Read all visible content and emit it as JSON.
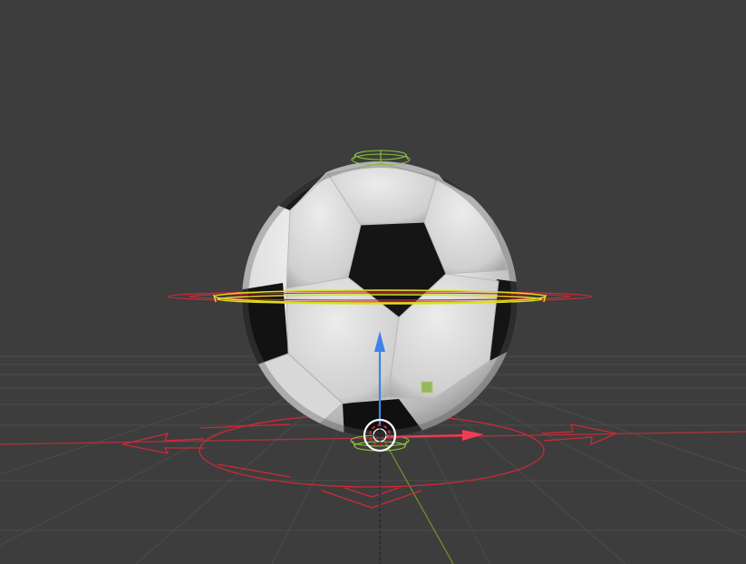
{
  "viewport": {
    "background_color": "#3d3d3d",
    "grid_color": "#4d4d4d",
    "x_axis_color": "#b0303c",
    "y_axis_color": "#6a8a2e",
    "z_axis_color": "#1f1f1f"
  },
  "scene_object": {
    "type": "soccer-ball",
    "selection_color": "#d8e020",
    "light_panel_color": "#e9e9e9",
    "dark_panel_color": "#151515"
  },
  "gizmo": {
    "translate_x_color": "#ee3d52",
    "translate_z_color": "#3f82e8",
    "plane_handle_color": "#7fb03a",
    "rotate_ring_color": "#cc2a36",
    "cage_color": "#8fc43a"
  }
}
